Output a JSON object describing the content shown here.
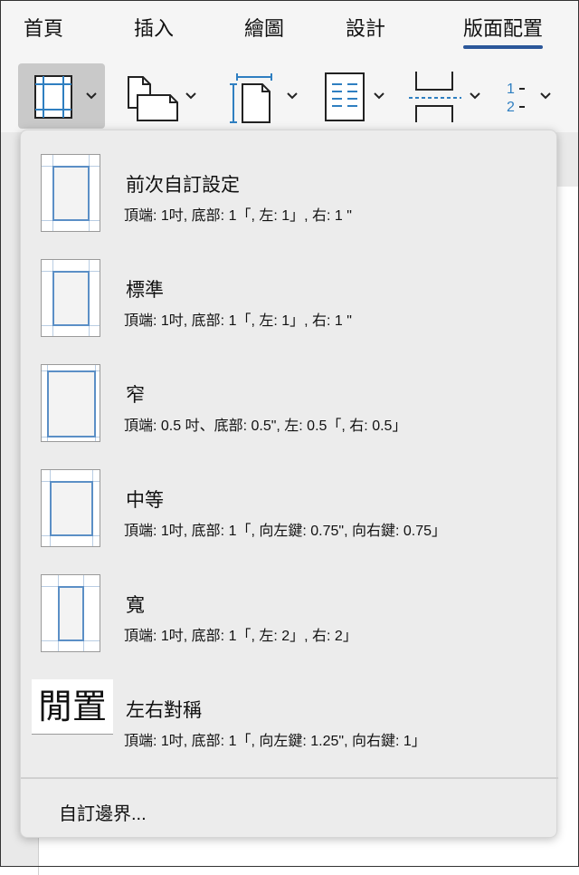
{
  "tabs": [
    "首頁",
    "插入",
    "繪圖",
    "設計",
    "版面配置"
  ],
  "active_tab": "版面配置",
  "toolbar": {
    "tools": [
      {
        "icon": "margins-icon"
      },
      {
        "icon": "orientation-icon"
      },
      {
        "icon": "size-icon"
      },
      {
        "icon": "columns-icon"
      },
      {
        "icon": "breaks-icon"
      },
      {
        "icon": "line-numbers-icon",
        "label_top": "1",
        "label_bottom": "2"
      }
    ]
  },
  "margins_menu": {
    "items": [
      {
        "title": "前次自訂設定",
        "desc": "頂端: 1吋, 底部: 1「, 左: 1」, 右: 1 \""
      },
      {
        "title": "標準",
        "desc": "頂端: 1吋, 底部: 1「, 左: 1」, 右: 1 \""
      },
      {
        "title": "窄",
        "desc": "頂端: 0.5 吋、底部: 0.5\", 左: 0.5「, 右: 0.5」"
      },
      {
        "title": "中等",
        "desc": "頂端: 1吋, 底部: 1「, 向左鍵: 0.75\", 向右鍵: 0.75」"
      },
      {
        "title": "寬",
        "desc": "頂端: 1吋, 底部: 1「, 左: 2」, 右: 2」"
      },
      {
        "title": "左右對稱",
        "desc": "頂端: 1吋, 底部: 1「, 向左鍵: 1.25\", 向右鍵: 1」",
        "thumb_text": "閒置"
      }
    ],
    "custom_label": "自訂邊界..."
  },
  "colors": {
    "accent": "#2b579a",
    "margin_line": "#5b8fc6"
  }
}
